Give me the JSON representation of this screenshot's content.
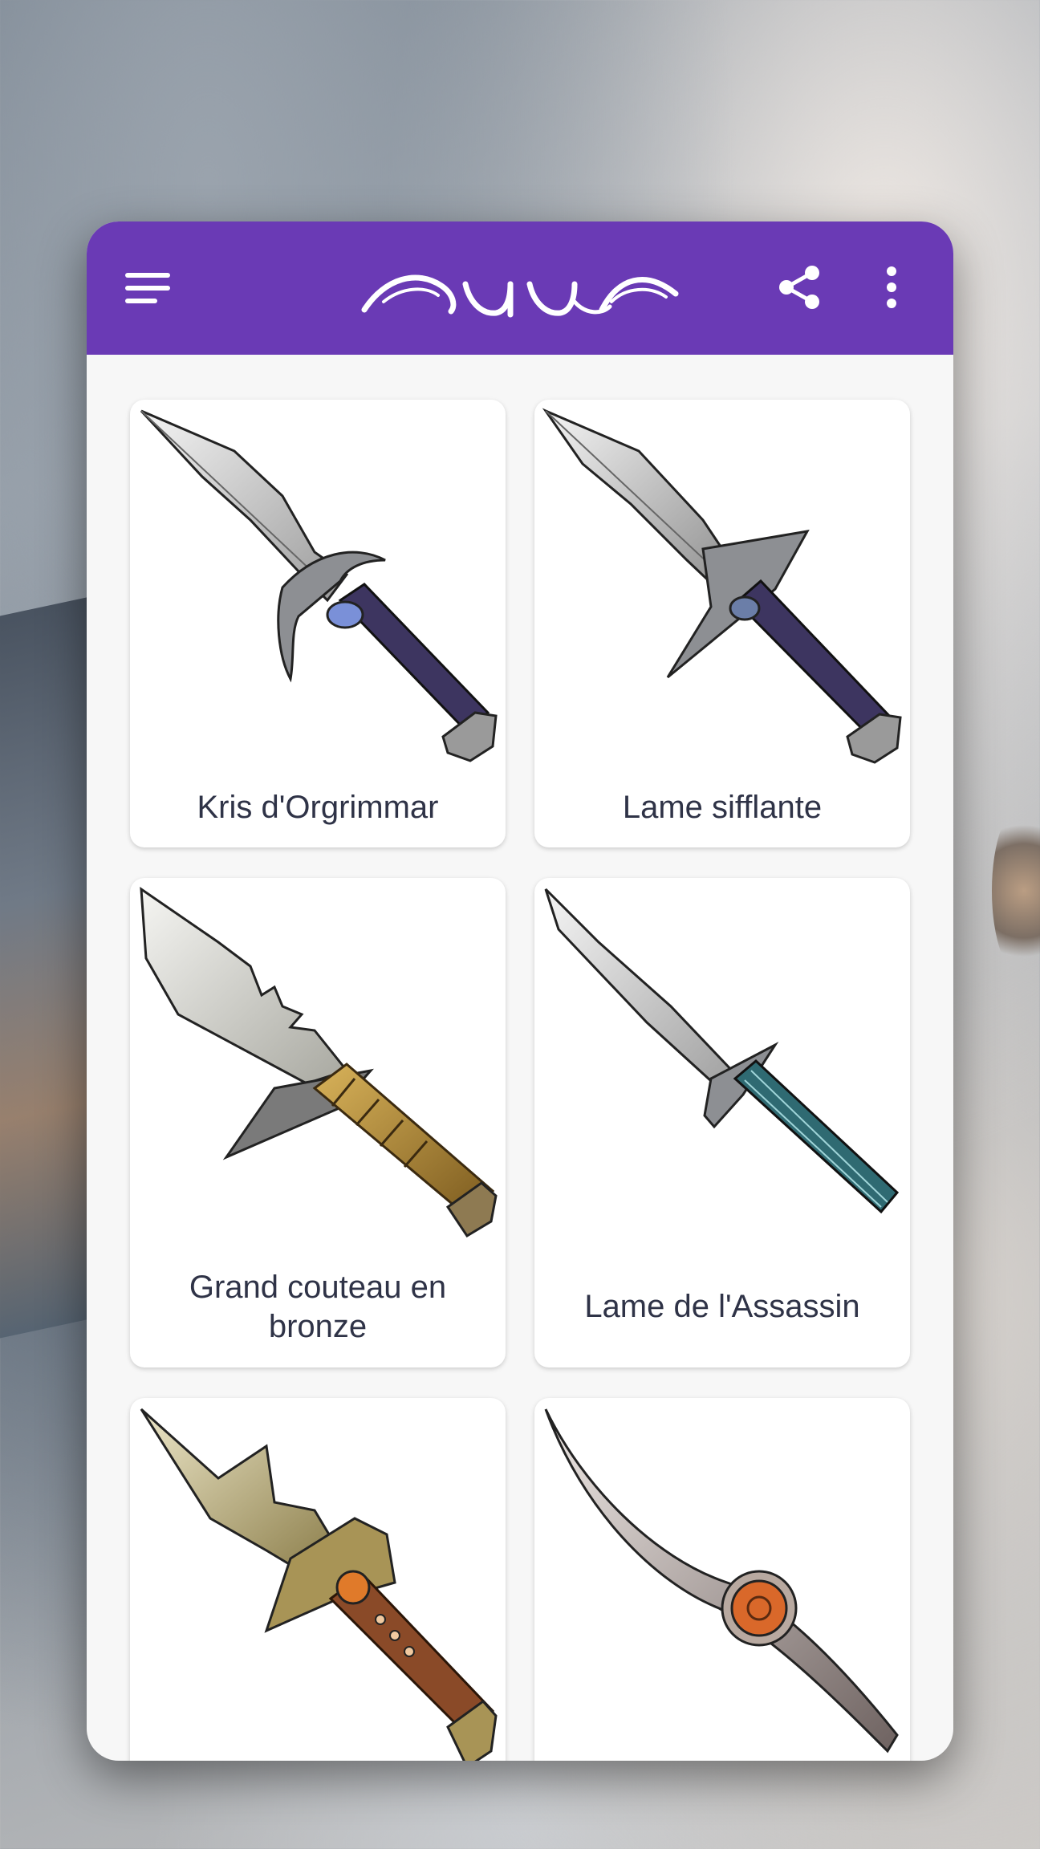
{
  "app": {
    "logo_icon": "swirl-logo",
    "colors": {
      "appbar": "#6a3ab5",
      "card": "#f7f7f7",
      "label": "#2f3347"
    }
  },
  "toolbar": {
    "menu_icon": "hamburger-menu-icon",
    "share_icon": "share-icon",
    "more_icon": "more-vert-icon"
  },
  "items": [
    {
      "label": "Kris d'Orgrimmar",
      "icon": "dagger-purple-hilt"
    },
    {
      "label": "Lame sifflante",
      "icon": "dagger-spiked-guard"
    },
    {
      "label": "Grand couteau en bronze",
      "icon": "serrated-bronze-knife"
    },
    {
      "label": "Lame de l'Assassin",
      "icon": "tanto-teal-grip"
    },
    {
      "label": "",
      "icon": "jagged-orange-gem-dagger"
    },
    {
      "label": "",
      "icon": "curved-orange-gem-blade"
    }
  ]
}
